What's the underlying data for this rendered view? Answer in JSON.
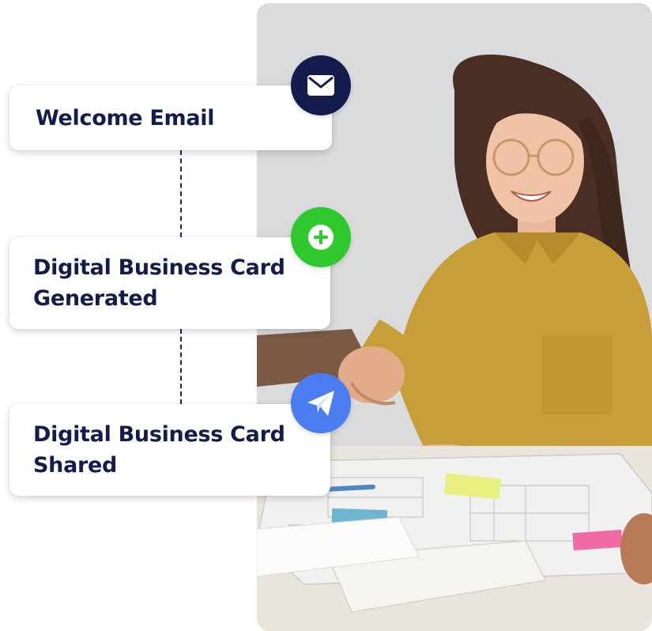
{
  "steps": [
    {
      "label": "Welcome Email",
      "icon": "envelope-icon",
      "color": "#141b4d"
    },
    {
      "label": "Digital Business Card\nGenerated",
      "icon": "plus-icon",
      "color": "#2fc92e"
    },
    {
      "label": "Digital Business Card\nShared",
      "icon": "paper-plane-icon",
      "color": "#4b7cf0"
    }
  ],
  "photo": {
    "description_icon": "handshake-photo"
  },
  "colors": {
    "text_navy": "#141b4d",
    "connector": "#1c2553",
    "shirt_mustard": "#c9a23a"
  }
}
